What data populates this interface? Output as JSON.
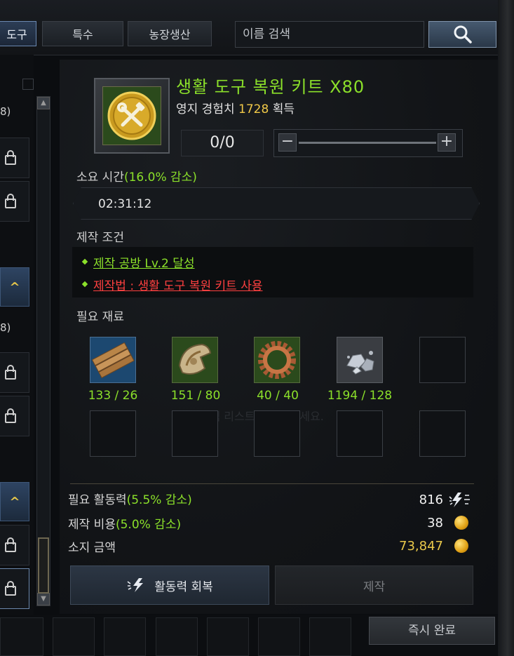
{
  "tabs": [
    {
      "label": "도구",
      "active": true
    },
    {
      "label": "특수",
      "active": false
    },
    {
      "label": "농장생산",
      "active": false
    }
  ],
  "search": {
    "placeholder": "이름 검색"
  },
  "left_list": {
    "count_a": "8)",
    "count_b": "8)"
  },
  "item": {
    "title": "생활 도구 복원 키트 X80",
    "reward_prefix": "영지 경험치",
    "reward_value": "1728",
    "reward_suffix": "획득",
    "icon": "wrench-hammer-coin-icon"
  },
  "quantity": {
    "value": "0/0",
    "minus": "−",
    "plus": "+"
  },
  "time": {
    "label": "소요 시간",
    "reduction": "(16.0% 감소)",
    "value": "02:31:12"
  },
  "conditions": {
    "label": "제작 조건",
    "items": [
      {
        "text": "제작 공방 Lv.2 달성",
        "met": true
      },
      {
        "text": "제작법 : 생활 도구 복원 키트 사용",
        "met": false
      }
    ]
  },
  "materials": {
    "label": "필요 재료",
    "items": [
      {
        "icon": "wood-planks-icon",
        "count": "133 / 26"
      },
      {
        "icon": "ancient-relic-icon",
        "count": "151 / 80"
      },
      {
        "icon": "gear-icon",
        "count": "40 / 40"
      },
      {
        "icon": "iron-ore-icon",
        "count": "1194 / 128"
      }
    ],
    "ghost_text": "아이템 리스트를 선택하세요."
  },
  "costs": {
    "energy_label": "필요 활동력",
    "energy_reduction": "(5.5% 감소)",
    "energy_value": "816",
    "cost_label": "제작 비용",
    "cost_reduction": "(5.0% 감소)",
    "cost_value": "38",
    "owned_label": "소지 금액",
    "owned_value": "73,847"
  },
  "buttons": {
    "recover_energy": "활동력 회복",
    "craft": "제작",
    "instant_complete": "즉시 완료"
  },
  "colors": {
    "accent_green": "#8be02a",
    "warn_red": "#ff4040",
    "gold": "#e8c84a"
  }
}
